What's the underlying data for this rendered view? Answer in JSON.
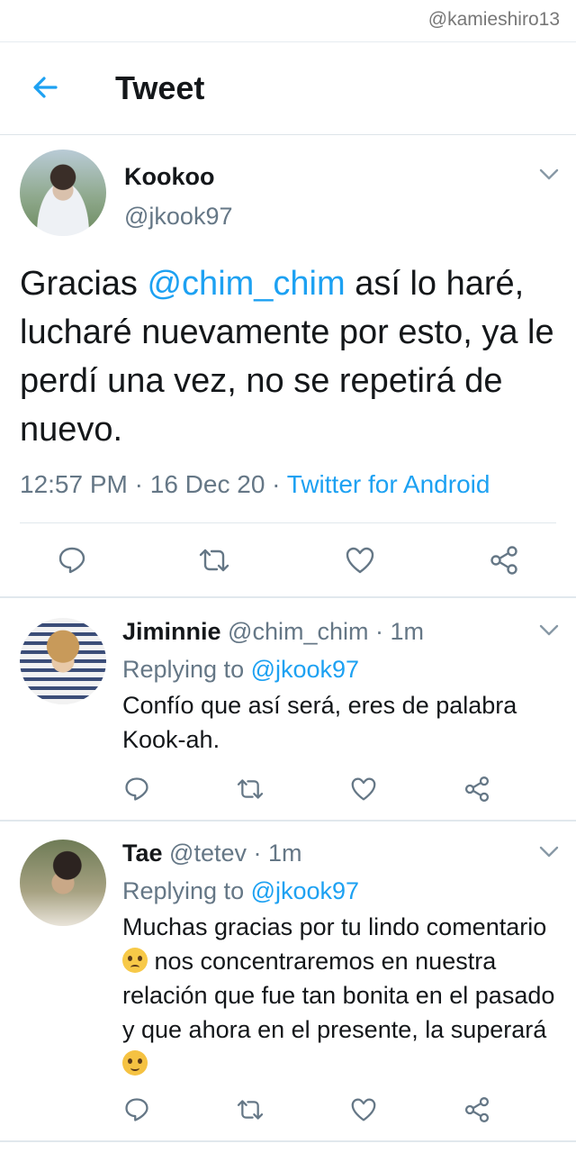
{
  "watermark": "@kamieshiro13",
  "header": {
    "title": "Tweet"
  },
  "tweet": {
    "name": "Kookoo",
    "handle": "@jkook97",
    "text_before": "Gracias ",
    "mention": "@chim_chim",
    "text_after": " así lo haré, lucharé nuevamente por esto, ya le perdí una vez, no se repetirá de nuevo.",
    "time": "12:57 PM",
    "sep1": " · ",
    "date": "16 Dec 20",
    "sep2": " · ",
    "source": "Twitter for Android"
  },
  "replies": [
    {
      "name": "Jiminnie",
      "handle": "@chim_chim",
      "dot": " · ",
      "time": "1m",
      "replying_label": "Replying to ",
      "replying_to": "@jkook97",
      "text": "Confío que así será, eres de palabra Kook-ah."
    },
    {
      "name": "Tae",
      "handle": "@tetev",
      "dot": " · ",
      "time": "1m",
      "replying_label": "Replying to ",
      "replying_to": "@jkook97",
      "text_1": "Muchas gracias por tu lindo comentario ",
      "emoji_1": "pleading-face",
      "text_2": " nos concentraremos en nuestra relación que fue tan bonita en el pasado y que ahora en el presente, la superará ",
      "emoji_2": "blushing-face"
    }
  ],
  "colors": {
    "accent": "#1da1f2",
    "muted": "#657786",
    "text": "#14171a",
    "divider": "#e1e8ed"
  }
}
